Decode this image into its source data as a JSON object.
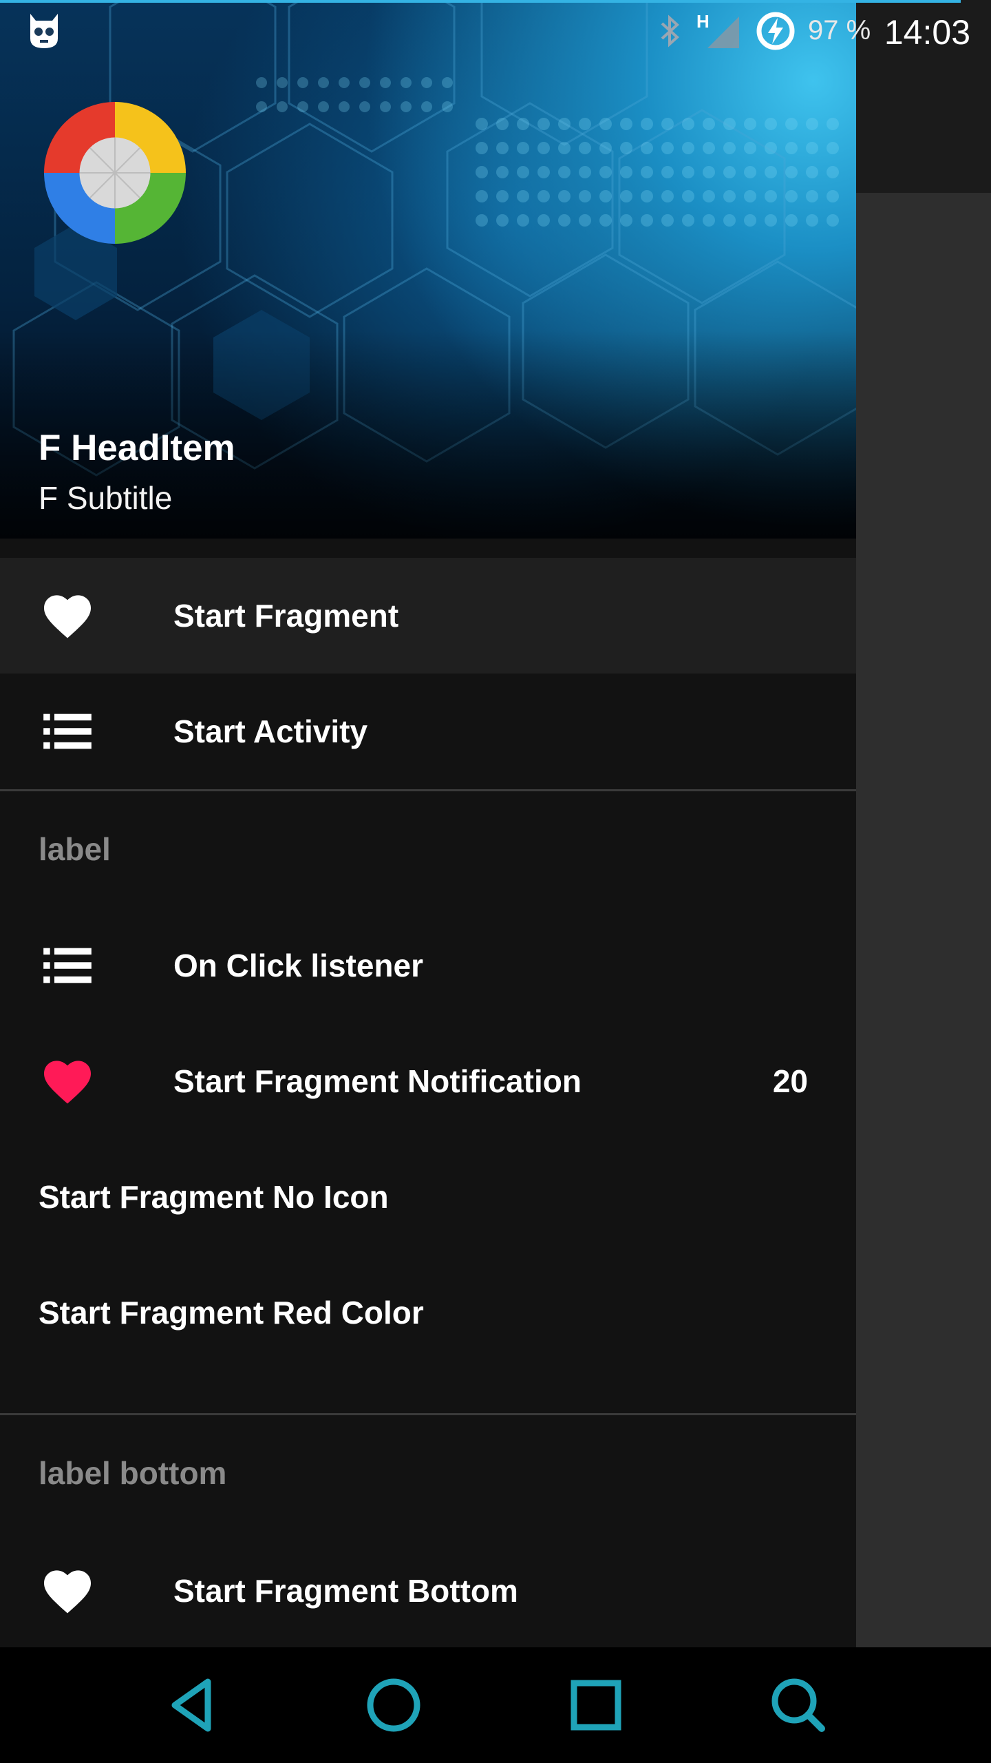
{
  "status_bar": {
    "battery": "97 %",
    "time": "14:03",
    "network": "H",
    "icons": [
      "android-head-icon",
      "bluetooth-icon",
      "signal-icon",
      "battery-charging-icon"
    ]
  },
  "header": {
    "title": "F HeadItem",
    "subtitle": "F Subtitle",
    "avatar_icon": "colorful-wheel-icon"
  },
  "menu": {
    "primary": [
      {
        "label": "Start Fragment",
        "icon": "heart-icon",
        "selected": true
      },
      {
        "label": "Start Activity",
        "icon": "list-icon"
      }
    ],
    "section1_label": "label",
    "section1": [
      {
        "label": "On Click listener",
        "icon": "list-icon"
      },
      {
        "label": "Start Fragment Notification",
        "icon": "heart-icon",
        "icon_color": "#ff1a57",
        "badge": "20"
      },
      {
        "label": "Start Fragment No Icon"
      },
      {
        "label": "Start Fragment Red Color"
      }
    ],
    "section2_label": "label bottom",
    "section2": [
      {
        "label": "Start Fragment Bottom",
        "icon": "heart-icon"
      }
    ]
  },
  "colors": {
    "drawer_bg": "#121212",
    "accent": "#1fa3b8",
    "heart_red": "#ff1a57",
    "status_line": "#34b3e4"
  },
  "nav_bar": {
    "buttons": [
      "back-icon",
      "home-icon",
      "recents-icon",
      "search-icon"
    ]
  }
}
